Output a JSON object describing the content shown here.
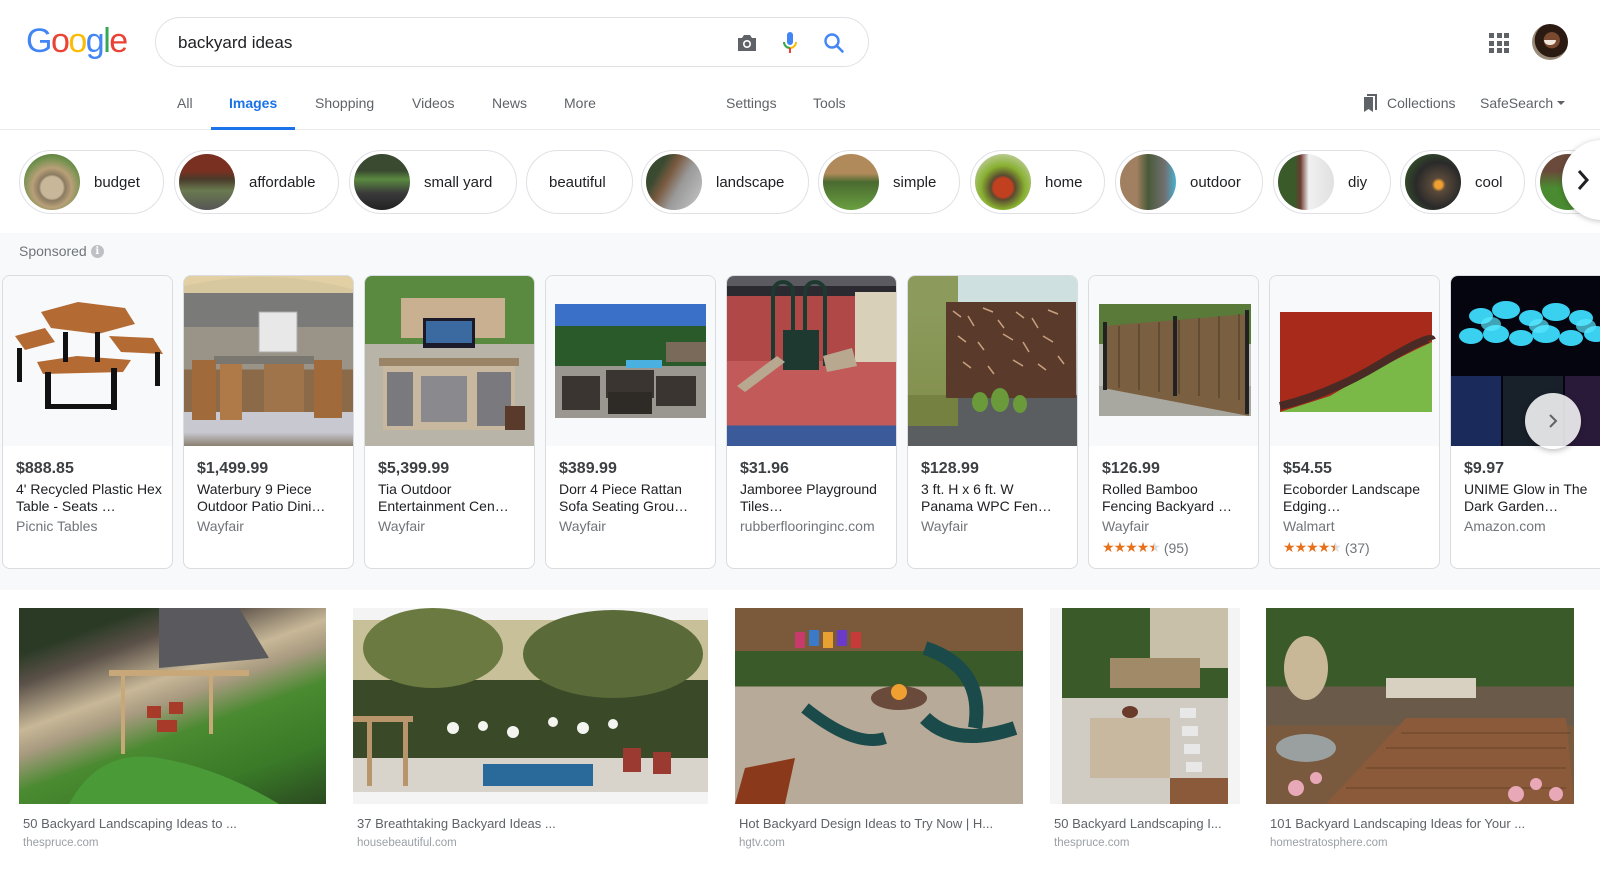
{
  "logo": {
    "letters": [
      "G",
      "o",
      "o",
      "g",
      "l",
      "e"
    ],
    "colors": [
      "#4285f4",
      "#ea4335",
      "#fbbc05",
      "#4285f4",
      "#34a853",
      "#ea4335"
    ]
  },
  "search": {
    "query": "backyard ideas",
    "camera_icon": "camera-icon",
    "mic_icon": "microphone-icon",
    "search_icon": "search-icon"
  },
  "header_right": {
    "apps_icon": "apps-grid-icon",
    "avatar": "user-avatar"
  },
  "tabs": [
    {
      "label": "All",
      "active": false
    },
    {
      "label": "Images",
      "active": true
    },
    {
      "label": "Shopping",
      "active": false
    },
    {
      "label": "Videos",
      "active": false
    },
    {
      "label": "News",
      "active": false
    },
    {
      "label": "More",
      "active": false
    },
    {
      "label": "Settings",
      "active": false
    },
    {
      "label": "Tools",
      "active": false
    }
  ],
  "collections_label": "Collections",
  "safesearch_label": "SafeSearch",
  "accent_color": "#1a73e8",
  "chips": [
    {
      "label": "budget",
      "has_image": true
    },
    {
      "label": "affordable",
      "has_image": true
    },
    {
      "label": "small yard",
      "has_image": true
    },
    {
      "label": "beautiful",
      "has_image": false
    },
    {
      "label": "landscape",
      "has_image": true
    },
    {
      "label": "simple",
      "has_image": true
    },
    {
      "label": "home",
      "has_image": true
    },
    {
      "label": "outdoor",
      "has_image": true
    },
    {
      "label": "diy",
      "has_image": true
    },
    {
      "label": "cool",
      "has_image": true
    }
  ],
  "sponsored": {
    "label": "Sponsored",
    "info_icon": "i",
    "products": [
      {
        "price": "$888.85",
        "title": "4' Recycled Plastic Hex Table - Seats …",
        "merchant": "Picnic Tables"
      },
      {
        "price": "$1,499.99",
        "title": "Waterbury 9 Piece Outdoor Patio Dini…",
        "merchant": "Wayfair"
      },
      {
        "price": "$5,399.99",
        "title": "Tia Outdoor Entertainment Cen…",
        "merchant": "Wayfair"
      },
      {
        "price": "$389.99",
        "title": "Dorr 4 Piece Rattan Sofa Seating Grou…",
        "merchant": "Wayfair"
      },
      {
        "price": "$31.96",
        "title": "Jamboree Playground Tiles…",
        "merchant": "rubberflooringinc.com"
      },
      {
        "price": "$128.99",
        "title": "3 ft. H x 6 ft. W Panama WPC Fen…",
        "merchant": "Wayfair"
      },
      {
        "price": "$126.99",
        "title": "Rolled Bamboo Fencing Backyard …",
        "merchant": "Wayfair",
        "stars": "★★★★★",
        "rating": 4.5,
        "reviews": "(95)"
      },
      {
        "price": "$54.55",
        "title": "Ecoborder Landscape Edging…",
        "merchant": "Walmart",
        "stars": "★★★★★",
        "rating": 4.5,
        "reviews": "(37)"
      },
      {
        "price": "$9.97",
        "title": "UNIME Glow in The Dark Garden…",
        "merchant": "Amazon.com"
      }
    ]
  },
  "results": [
    {
      "title": "50 Backyard Landscaping Ideas to ...",
      "source": "thespruce.com"
    },
    {
      "title": "37 Breathtaking Backyard Ideas ...",
      "source": "housebeautiful.com"
    },
    {
      "title": "Hot Backyard Design Ideas to Try Now | H...",
      "source": "hgtv.com"
    },
    {
      "title": "50 Backyard Landscaping I...",
      "source": "thespruce.com"
    },
    {
      "title": "101 Backyard Landscaping Ideas for Your ...",
      "source": "homestratosphere.com"
    }
  ]
}
